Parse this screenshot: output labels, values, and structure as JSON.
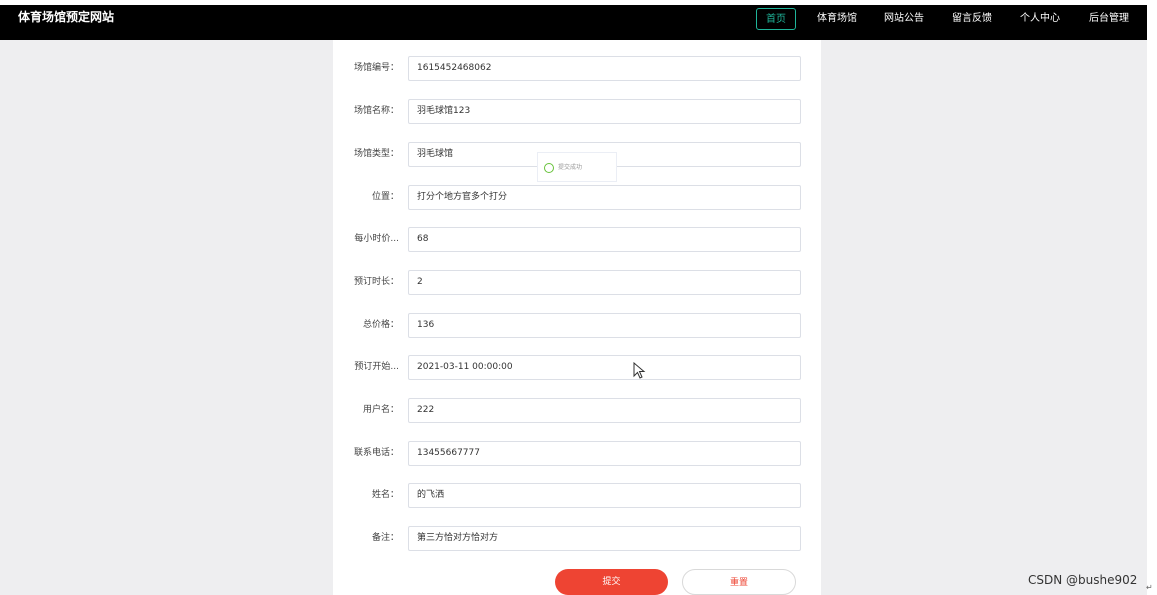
{
  "header": {
    "site_title": "体育场馆预定网站",
    "nav": [
      {
        "label": "首页",
        "active": true
      },
      {
        "label": "体育场馆",
        "active": false
      },
      {
        "label": "网站公告",
        "active": false
      },
      {
        "label": "留言反馈",
        "active": false
      },
      {
        "label": "个人中心",
        "active": false
      },
      {
        "label": "后台管理",
        "active": false
      }
    ]
  },
  "form": {
    "fields": [
      {
        "label": "场馆编号：",
        "value": "1615452468062"
      },
      {
        "label": "场馆名称：",
        "value": "羽毛球馆123"
      },
      {
        "label": "场馆类型：",
        "value": "羽毛球馆"
      },
      {
        "label": "位置：",
        "value": "打分个地方官多个打分"
      },
      {
        "label": "每小时价...",
        "value": "68"
      },
      {
        "label": "预订时长：",
        "value": "2"
      },
      {
        "label": "总价格：",
        "value": "136"
      },
      {
        "label": "预订开始...",
        "value": "2021-03-11 00:00:00"
      },
      {
        "label": "用户名：",
        "value": "222"
      },
      {
        "label": "联系电话：",
        "value": "13455667777"
      },
      {
        "label": "姓名：",
        "value": "的飞洒"
      },
      {
        "label": "备注：",
        "value": "第三方恰对方恰对方"
      }
    ],
    "submit_label": "提交",
    "reset_label": "重置"
  },
  "toast": {
    "text": "提交成功"
  },
  "watermark": "CSDN @bushe902",
  "colors": {
    "accent": "#1fb59a",
    "submit": "#ee4433",
    "background": "#eeeef0",
    "header": "#000000"
  },
  "icons": {
    "toast_icon": "success-circle-icon",
    "cursor": "mouse-pointer-icon"
  }
}
